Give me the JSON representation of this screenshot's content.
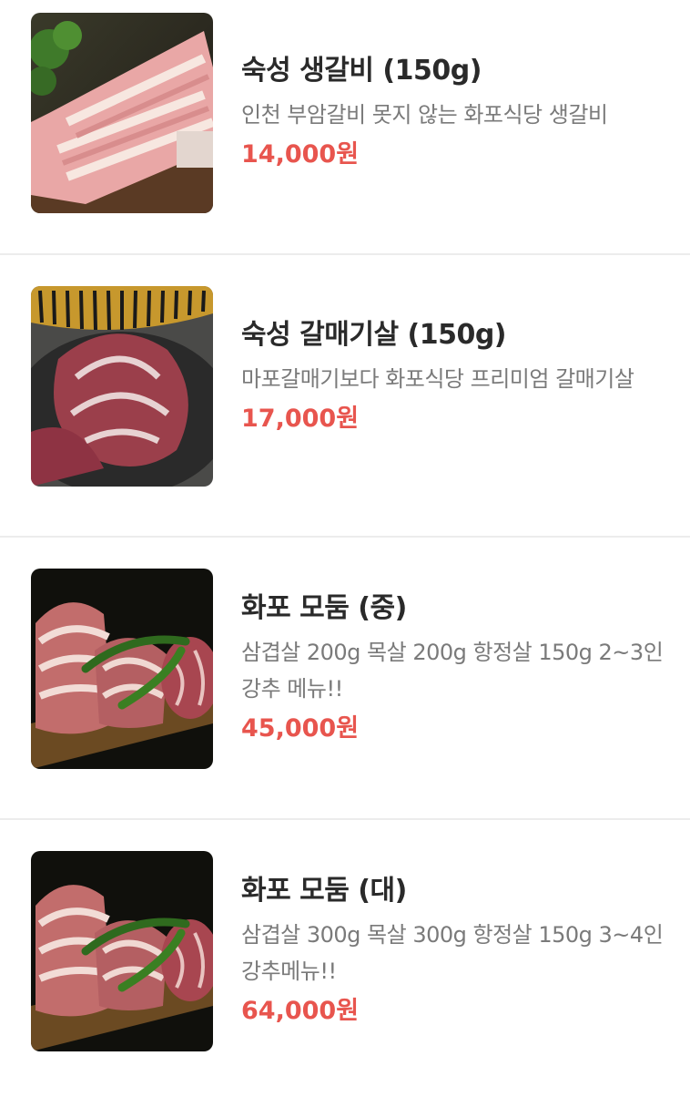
{
  "menu": {
    "items": [
      {
        "name": "숙성 생갈비 (150g)",
        "description": "인천 부암갈비 못지 않는 화포식당 생갈비",
        "price": "14,000원",
        "image_icon": "pork-ribs-photo-icon"
      },
      {
        "name": "숙성 갈매기살 (150g)",
        "description": "마포갈매기보다 화포식당 프리미엄 갈매기살",
        "price": "17,000원",
        "image_icon": "pork-skirt-photo-icon"
      },
      {
        "name": "화포 모둠 (중)",
        "description": "삼겹살 200g 목살 200g 항정살 150g 2~3인 강추 메뉴!!",
        "price": "45,000원",
        "image_icon": "assorted-pork-photo-icon"
      },
      {
        "name": "화포 모둠 (대)",
        "description": "삼겹살 300g 목살 300g 항정살 150g 3~4인 강추메뉴!!",
        "price": "64,000원",
        "image_icon": "assorted-pork-photo-icon"
      }
    ]
  },
  "colors": {
    "price": "#e8554e",
    "name": "#2a2a2a",
    "description": "#7a7a7a",
    "divider": "#ececec"
  }
}
